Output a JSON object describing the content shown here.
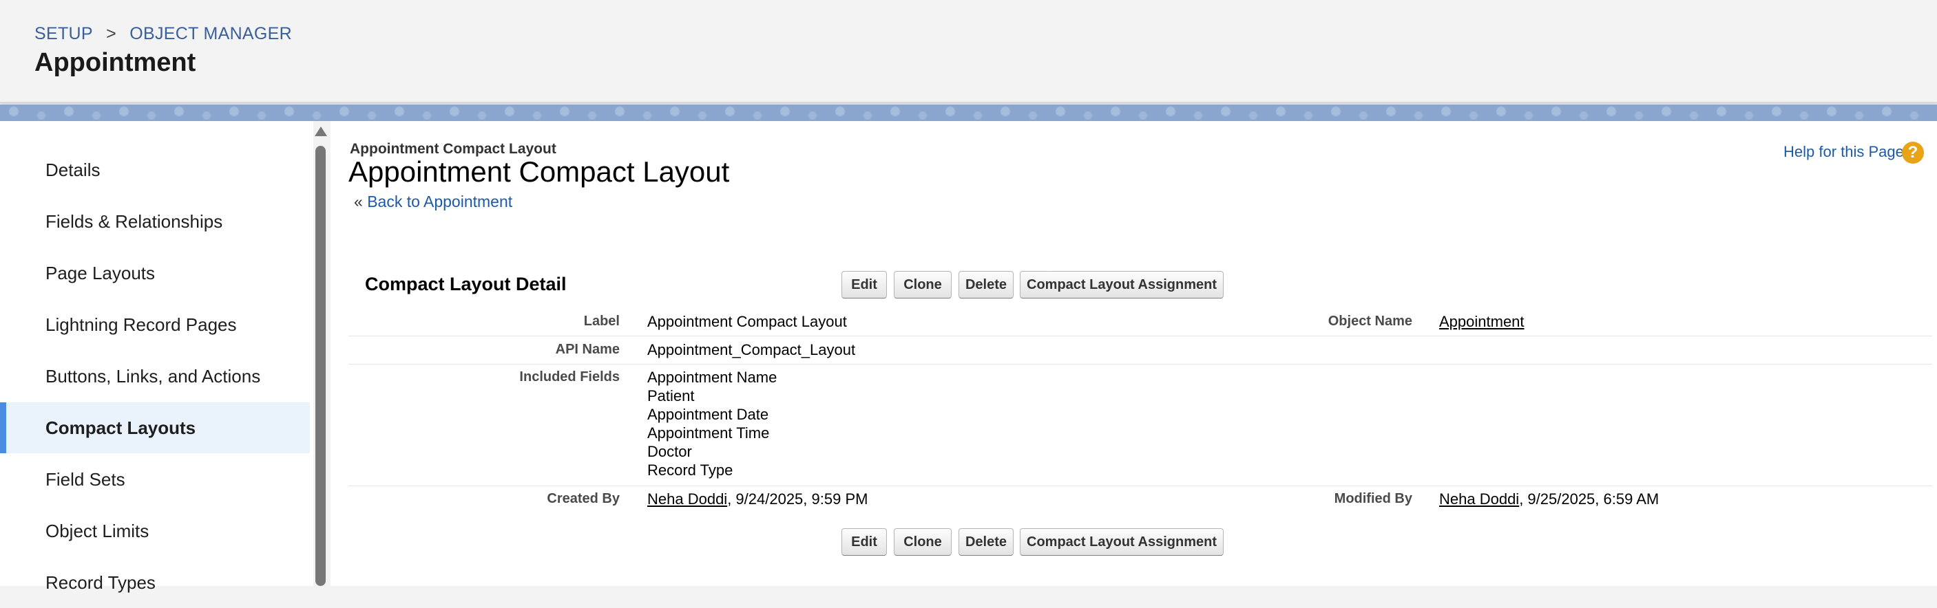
{
  "header": {
    "breadcrumb": {
      "setup": "SETUP",
      "separator": ">",
      "object_manager": "OBJECT MANAGER"
    },
    "title": "Appointment"
  },
  "sidebar": {
    "items": [
      {
        "label": "Details"
      },
      {
        "label": "Fields & Relationships"
      },
      {
        "label": "Page Layouts"
      },
      {
        "label": "Lightning Record Pages"
      },
      {
        "label": "Buttons, Links, and Actions"
      },
      {
        "label": "Compact Layouts",
        "active": true
      },
      {
        "label": "Field Sets"
      },
      {
        "label": "Object Limits"
      },
      {
        "label": "Record Types"
      }
    ]
  },
  "main": {
    "small_title": "Appointment Compact Layout",
    "big_title": "Appointment Compact Layout",
    "back_prefix": "«",
    "back_link": "Back to Appointment",
    "help_link": "Help for this Page",
    "help_icon": "?",
    "section_title": "Compact Layout Detail",
    "buttons": {
      "edit": "Edit",
      "clone": "Clone",
      "delete": "Delete",
      "assignment": "Compact Layout Assignment"
    },
    "detail": {
      "label_label": "Label",
      "label_value": "Appointment Compact Layout",
      "object_name_label": "Object Name",
      "object_name_value": "Appointment",
      "api_name_label": "API Name",
      "api_name_value": "Appointment_Compact_Layout",
      "included_fields_label": "Included Fields",
      "included_fields": [
        "Appointment Name",
        "Patient",
        "Appointment Date",
        "Appointment Time",
        "Doctor",
        "Record Type"
      ],
      "created_by_label": "Created By",
      "created_by_user": "Neha Doddi",
      "created_by_date": ", 9/24/2025, 9:59 PM",
      "modified_by_label": "Modified By",
      "modified_by_user": "Neha Doddi",
      "modified_by_date": ", 9/25/2025, 6:59 AM"
    }
  },
  "colors": {
    "link": "#1c5aa8",
    "active_nav_bg": "#eaf3fc",
    "active_nav_bar": "#4a8de0",
    "help_icon": "#e8a317",
    "banner": "#8aa6cf"
  }
}
